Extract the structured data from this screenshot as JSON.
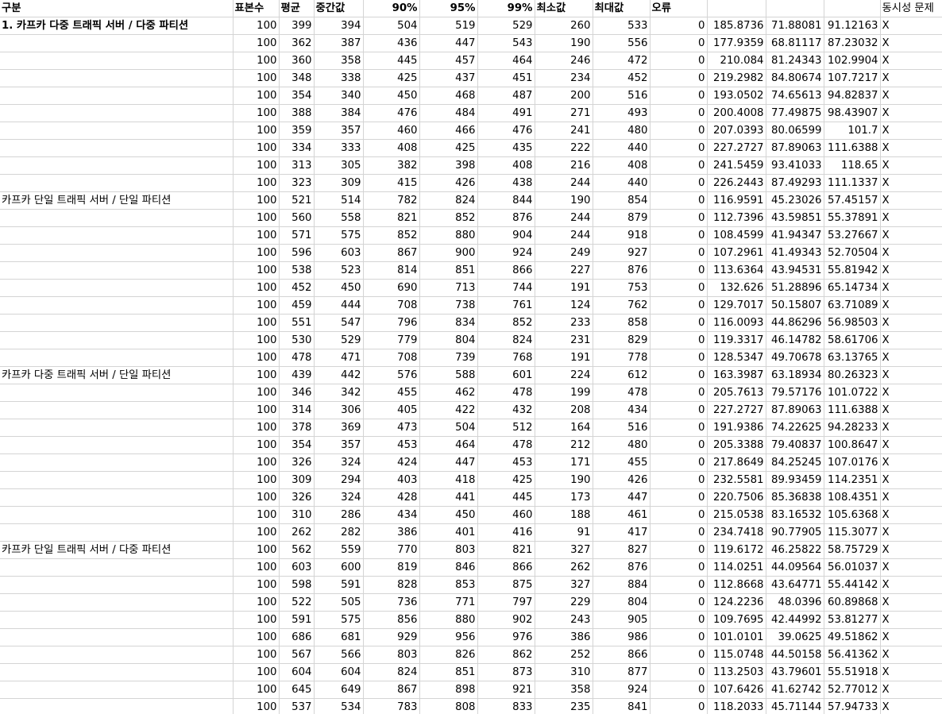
{
  "headers": [
    "구분",
    "표본수",
    "평균",
    "중간값",
    "90%",
    "95%",
    "99%",
    "최소값",
    "최대값",
    "오류",
    "",
    "",
    "",
    "동시성 문제"
  ],
  "groups": [
    {
      "label": "1. 카프카 다중 트래픽 서버 / 다중 파티션",
      "bold": true,
      "rows": [
        [
          "100",
          "399",
          "394",
          "504",
          "519",
          "529",
          "260",
          "533",
          "0",
          "185.8736",
          "71.88081",
          "91.12163",
          "X"
        ],
        [
          "100",
          "362",
          "387",
          "436",
          "447",
          "543",
          "190",
          "556",
          "0",
          "177.9359",
          "68.81117",
          "87.23032",
          "X"
        ],
        [
          "100",
          "360",
          "358",
          "445",
          "457",
          "464",
          "246",
          "472",
          "0",
          "210.084",
          "81.24343",
          "102.9904",
          "X"
        ],
        [
          "100",
          "348",
          "338",
          "425",
          "437",
          "451",
          "234",
          "452",
          "0",
          "219.2982",
          "84.80674",
          "107.7217",
          "X"
        ],
        [
          "100",
          "354",
          "340",
          "450",
          "468",
          "487",
          "200",
          "516",
          "0",
          "193.0502",
          "74.65613",
          "94.82837",
          "X"
        ],
        [
          "100",
          "388",
          "384",
          "476",
          "484",
          "491",
          "271",
          "493",
          "0",
          "200.4008",
          "77.49875",
          "98.43907",
          "X"
        ],
        [
          "100",
          "359",
          "357",
          "460",
          "466",
          "476",
          "241",
          "480",
          "0",
          "207.0393",
          "80.06599",
          "101.7",
          "X"
        ],
        [
          "100",
          "334",
          "333",
          "408",
          "425",
          "435",
          "222",
          "440",
          "0",
          "227.2727",
          "87.89063",
          "111.6388",
          "X"
        ],
        [
          "100",
          "313",
          "305",
          "382",
          "398",
          "408",
          "216",
          "408",
          "0",
          "241.5459",
          "93.41033",
          "118.65",
          "X"
        ],
        [
          "100",
          "323",
          "309",
          "415",
          "426",
          "438",
          "244",
          "440",
          "0",
          "226.2443",
          "87.49293",
          "111.1337",
          "X"
        ]
      ]
    },
    {
      "label": "카프카 단일 트래픽 서버 / 단일 파티션",
      "bold": false,
      "rows": [
        [
          "100",
          "521",
          "514",
          "782",
          "824",
          "844",
          "190",
          "854",
          "0",
          "116.9591",
          "45.23026",
          "57.45157",
          "X"
        ],
        [
          "100",
          "560",
          "558",
          "821",
          "852",
          "876",
          "244",
          "879",
          "0",
          "112.7396",
          "43.59851",
          "55.37891",
          "X"
        ],
        [
          "100",
          "571",
          "575",
          "852",
          "880",
          "904",
          "244",
          "918",
          "0",
          "108.4599",
          "41.94347",
          "53.27667",
          "X"
        ],
        [
          "100",
          "596",
          "603",
          "867",
          "900",
          "924",
          "249",
          "927",
          "0",
          "107.2961",
          "41.49343",
          "52.70504",
          "X"
        ],
        [
          "100",
          "538",
          "523",
          "814",
          "851",
          "866",
          "227",
          "876",
          "0",
          "113.6364",
          "43.94531",
          "55.81942",
          "X"
        ],
        [
          "100",
          "452",
          "450",
          "690",
          "713",
          "744",
          "191",
          "753",
          "0",
          "132.626",
          "51.28896",
          "65.14734",
          "X"
        ],
        [
          "100",
          "459",
          "444",
          "708",
          "738",
          "761",
          "124",
          "762",
          "0",
          "129.7017",
          "50.15807",
          "63.71089",
          "X"
        ],
        [
          "100",
          "551",
          "547",
          "796",
          "834",
          "852",
          "233",
          "858",
          "0",
          "116.0093",
          "44.86296",
          "56.98503",
          "X"
        ],
        [
          "100",
          "530",
          "529",
          "779",
          "804",
          "824",
          "231",
          "829",
          "0",
          "119.3317",
          "46.14782",
          "58.61706",
          "X"
        ],
        [
          "100",
          "478",
          "471",
          "708",
          "739",
          "768",
          "191",
          "778",
          "0",
          "128.5347",
          "49.70678",
          "63.13765",
          "X"
        ]
      ]
    },
    {
      "label": "카프카 다중 트래픽 서버 / 단일 파티션",
      "bold": false,
      "rows": [
        [
          "100",
          "439",
          "442",
          "576",
          "588",
          "601",
          "224",
          "612",
          "0",
          "163.3987",
          "63.18934",
          "80.26323",
          "X"
        ],
        [
          "100",
          "346",
          "342",
          "455",
          "462",
          "478",
          "199",
          "478",
          "0",
          "205.7613",
          "79.57176",
          "101.0722",
          "X"
        ],
        [
          "100",
          "314",
          "306",
          "405",
          "422",
          "432",
          "208",
          "434",
          "0",
          "227.2727",
          "87.89063",
          "111.6388",
          "X"
        ],
        [
          "100",
          "378",
          "369",
          "473",
          "504",
          "512",
          "164",
          "516",
          "0",
          "191.9386",
          "74.22625",
          "94.28233",
          "X"
        ],
        [
          "100",
          "354",
          "357",
          "453",
          "464",
          "478",
          "212",
          "480",
          "0",
          "205.3388",
          "79.40837",
          "100.8647",
          "X"
        ],
        [
          "100",
          "326",
          "324",
          "424",
          "447",
          "453",
          "171",
          "455",
          "0",
          "217.8649",
          "84.25245",
          "107.0176",
          "X"
        ],
        [
          "100",
          "309",
          "294",
          "403",
          "418",
          "425",
          "190",
          "426",
          "0",
          "232.5581",
          "89.93459",
          "114.2351",
          "X"
        ],
        [
          "100",
          "326",
          "324",
          "428",
          "441",
          "445",
          "173",
          "447",
          "0",
          "220.7506",
          "85.36838",
          "108.4351",
          "X"
        ],
        [
          "100",
          "310",
          "286",
          "434",
          "450",
          "460",
          "188",
          "461",
          "0",
          "215.0538",
          "83.16532",
          "105.6368",
          "X"
        ],
        [
          "100",
          "262",
          "282",
          "386",
          "401",
          "416",
          "91",
          "417",
          "0",
          "234.7418",
          "90.77905",
          "115.3077",
          "X"
        ]
      ]
    },
    {
      "label": "카프카 단일 트래픽 서버 / 다중 파티션",
      "bold": false,
      "rows": [
        [
          "100",
          "562",
          "559",
          "770",
          "803",
          "821",
          "327",
          "827",
          "0",
          "119.6172",
          "46.25822",
          "58.75729",
          "X"
        ],
        [
          "100",
          "603",
          "600",
          "819",
          "846",
          "866",
          "262",
          "876",
          "0",
          "114.0251",
          "44.09564",
          "56.01037",
          "X"
        ],
        [
          "100",
          "598",
          "591",
          "828",
          "853",
          "875",
          "327",
          "884",
          "0",
          "112.8668",
          "43.64771",
          "55.44142",
          "X"
        ],
        [
          "100",
          "522",
          "505",
          "736",
          "771",
          "797",
          "229",
          "804",
          "0",
          "124.2236",
          "48.0396",
          "60.89868",
          "X"
        ],
        [
          "100",
          "591",
          "575",
          "856",
          "880",
          "902",
          "243",
          "905",
          "0",
          "109.7695",
          "42.44992",
          "53.81277",
          "X"
        ],
        [
          "100",
          "686",
          "681",
          "929",
          "956",
          "976",
          "386",
          "986",
          "0",
          "101.0101",
          "39.0625",
          "49.51862",
          "X"
        ],
        [
          "100",
          "567",
          "566",
          "803",
          "826",
          "862",
          "252",
          "866",
          "0",
          "115.0748",
          "44.50158",
          "56.41362",
          "X"
        ],
        [
          "100",
          "604",
          "604",
          "824",
          "851",
          "873",
          "310",
          "877",
          "0",
          "113.2503",
          "43.79601",
          "55.51918",
          "X"
        ],
        [
          "100",
          "645",
          "649",
          "867",
          "898",
          "921",
          "358",
          "924",
          "0",
          "107.6426",
          "41.62742",
          "52.77012",
          "X"
        ],
        [
          "100",
          "537",
          "534",
          "783",
          "808",
          "833",
          "235",
          "841",
          "0",
          "118.2033",
          "45.71144",
          "57.94733",
          "X"
        ]
      ]
    }
  ]
}
